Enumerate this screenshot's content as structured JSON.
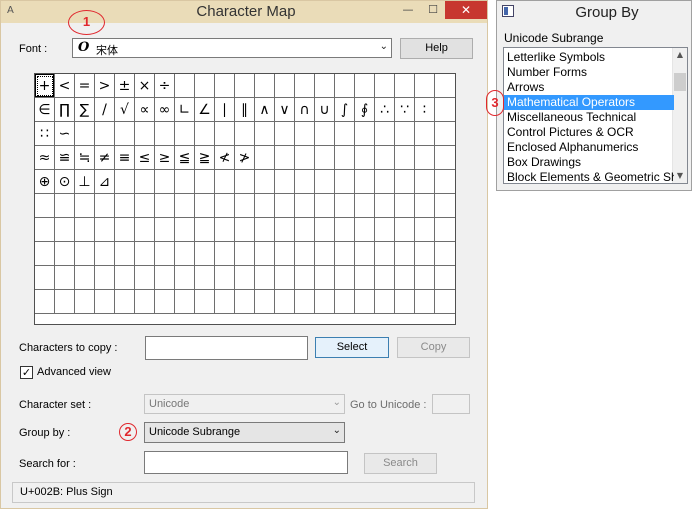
{
  "main_window": {
    "title": "Character Map",
    "app_icon": "A"
  },
  "window_controls": {
    "minimize": "—",
    "maximize": "☐",
    "close": "✕"
  },
  "font": {
    "label": "Font :",
    "value": "宋体",
    "type_icon": "O",
    "icon": "open-type-font-icon"
  },
  "help_label": "Help",
  "grid": {
    "rows": [
      [
        "+",
        "<",
        "=",
        ">",
        "±",
        "×",
        "÷",
        "",
        "",
        "",
        "",
        "",
        "",
        "",
        "",
        "",
        "",
        "",
        "",
        "",
        ""
      ],
      [
        "∈",
        "∏",
        "∑",
        "/",
        "√",
        "∝",
        "∞",
        "∟",
        "∠",
        "∣",
        "∥",
        "∧",
        "∨",
        "∩",
        "∪",
        "∫",
        "∮",
        "∴",
        "∵",
        "∶",
        ""
      ],
      [
        "∷",
        "∽",
        "",
        "",
        "",
        "",
        "",
        "",
        "",
        "",
        "",
        "",
        "",
        "",
        "",
        "",
        "",
        "",
        "",
        "",
        ""
      ],
      [
        "≈",
        "≌",
        "≒",
        "≠",
        "≡",
        "≤",
        "≥",
        "≦",
        "≧",
        "≮",
        "≯",
        "",
        "",
        "",
        "",
        "",
        "",
        "",
        "",
        "",
        ""
      ],
      [
        "⊕",
        "⊙",
        "⊥",
        "⊿",
        "",
        "",
        "",
        "",
        "",
        "",
        "",
        "",
        "",
        "",
        "",
        "",
        "",
        "",
        "",
        "",
        ""
      ],
      [
        "",
        "",
        "",
        "",
        "",
        "",
        "",
        "",
        "",
        "",
        "",
        "",
        "",
        "",
        "",
        "",
        "",
        "",
        "",
        "",
        ""
      ],
      [
        "",
        "",
        "",
        "",
        "",
        "",
        "",
        "",
        "",
        "",
        "",
        "",
        "",
        "",
        "",
        "",
        "",
        "",
        "",
        "",
        ""
      ],
      [
        "",
        "",
        "",
        "",
        "",
        "",
        "",
        "",
        "",
        "",
        "",
        "",
        "",
        "",
        "",
        "",
        "",
        "",
        "",
        "",
        ""
      ],
      [
        "",
        "",
        "",
        "",
        "",
        "",
        "",
        "",
        "",
        "",
        "",
        "",
        "",
        "",
        "",
        "",
        "",
        "",
        "",
        "",
        ""
      ],
      [
        "",
        "",
        "",
        "",
        "",
        "",
        "",
        "",
        "",
        "",
        "",
        "",
        "",
        "",
        "",
        "",
        "",
        "",
        "",
        "",
        ""
      ]
    ],
    "selected": [
      0,
      0
    ]
  },
  "copy_area": {
    "label": "Characters to copy :",
    "value": "",
    "select_label": "Select",
    "copy_label": "Copy"
  },
  "advanced_view": {
    "label": "Advanced view",
    "checked": true,
    "check_glyph": "✓"
  },
  "character_set": {
    "label": "Character set :",
    "value": "Unicode"
  },
  "goto_unicode": {
    "label": "Go to Unicode :",
    "value": ""
  },
  "group_by": {
    "label": "Group by :",
    "value": "Unicode Subrange"
  },
  "search": {
    "label": "Search for :",
    "value": "",
    "button_label": "Search"
  },
  "status": "U+002B: Plus Sign",
  "groupby_window": {
    "title": "Group By",
    "list_label": "Unicode Subrange",
    "items": [
      "Letterlike Symbols",
      "Number Forms",
      "Arrows",
      "Mathematical Operators",
      "Miscellaneous Technical",
      "Control Pictures & OCR",
      "Enclosed Alphanumerics",
      "Box Drawings",
      "Block Elements & Geometric Shapes"
    ],
    "selected_index": 3,
    "scroll_up": "▲",
    "scroll_down": "▼"
  },
  "steps": [
    "1",
    "2",
    "3"
  ],
  "chevron": "⌄",
  "colors": {
    "accent": "#3399ff",
    "annotation": "#e0282e",
    "close_button": "#c7372f",
    "titlebar": "#eadcb8"
  }
}
